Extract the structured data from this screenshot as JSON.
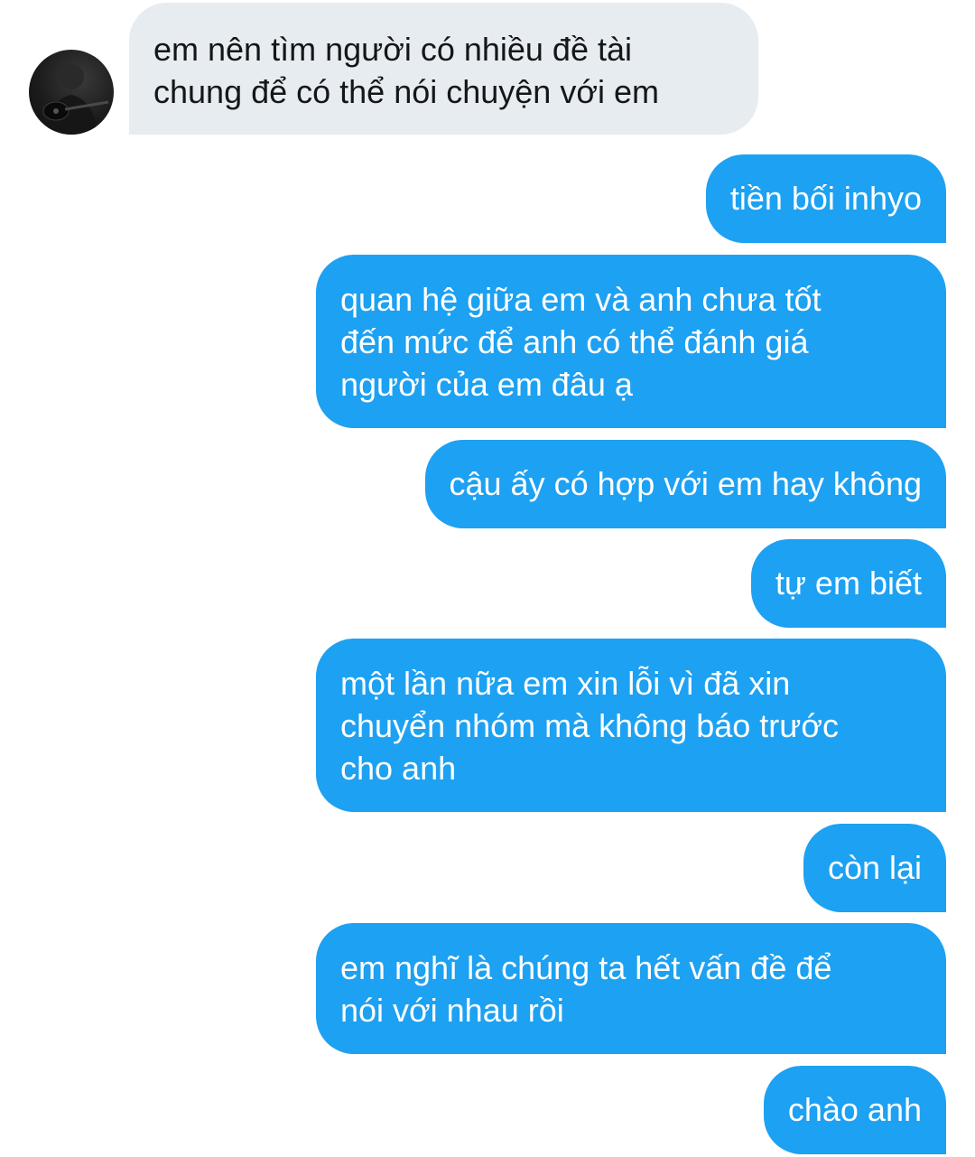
{
  "conversation": {
    "received_message": "em nên tìm người có nhiều đề tài\nchung để có thể nói chuyện với em",
    "sent_messages": [
      "tiền bối inhyo",
      "quan hệ giữa em và anh chưa tốt\nđến mức để anh có thể đánh giá\nngười của em đâu ạ",
      "cậu ấy có hợp với em hay không",
      "tự em biết",
      "một lần nữa em xin lỗi vì đã xin\nchuyển nhóm mà không báo trước\ncho anh",
      "còn lại",
      "em nghĩ là chúng ta hết vấn đề để\nnói với nhau rồi",
      "chào anh"
    ]
  },
  "colors": {
    "sent_bubble": "#1da1f2",
    "received_bubble": "#e7ecf0",
    "sent_text": "#ffffff",
    "received_text": "#14171a"
  },
  "icons": {
    "avatar": "user-avatar-guitar-photo"
  }
}
